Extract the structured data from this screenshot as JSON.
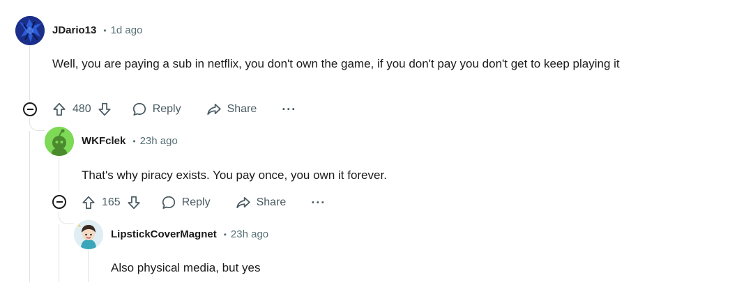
{
  "comments": [
    {
      "user": "JDario13",
      "time": "1d ago",
      "text": "Well, you are paying a sub in netflix, you don't own the game, if you don't pay you don't get to keep playing it",
      "score": "480",
      "reply_label": "Reply",
      "share_label": "Share",
      "more_label": "···"
    },
    {
      "user": "WKFclek",
      "time": "23h ago",
      "text": "That's why piracy exists. You pay once, you own it forever.",
      "score": "165",
      "reply_label": "Reply",
      "share_label": "Share",
      "more_label": "···"
    },
    {
      "user": "LipstickCoverMagnet",
      "time": "23h ago",
      "text": "Also physical media, but yes"
    }
  ],
  "separator": "•",
  "colors": {
    "text": "#1a1a1b",
    "meta": "#576f76",
    "action": "#4a5b63",
    "thread_line": "#dfe3e6",
    "avatar1_bg": "#1f3a9e",
    "avatar2_bg": "#7ed957",
    "avatar3_bg": "#cfe3e9"
  },
  "icons": {
    "upvote": "upvote-icon",
    "downvote": "downvote-icon",
    "reply": "comment-bubble-icon",
    "share": "share-arrow-icon",
    "collapse": "collapse-minus-icon"
  }
}
